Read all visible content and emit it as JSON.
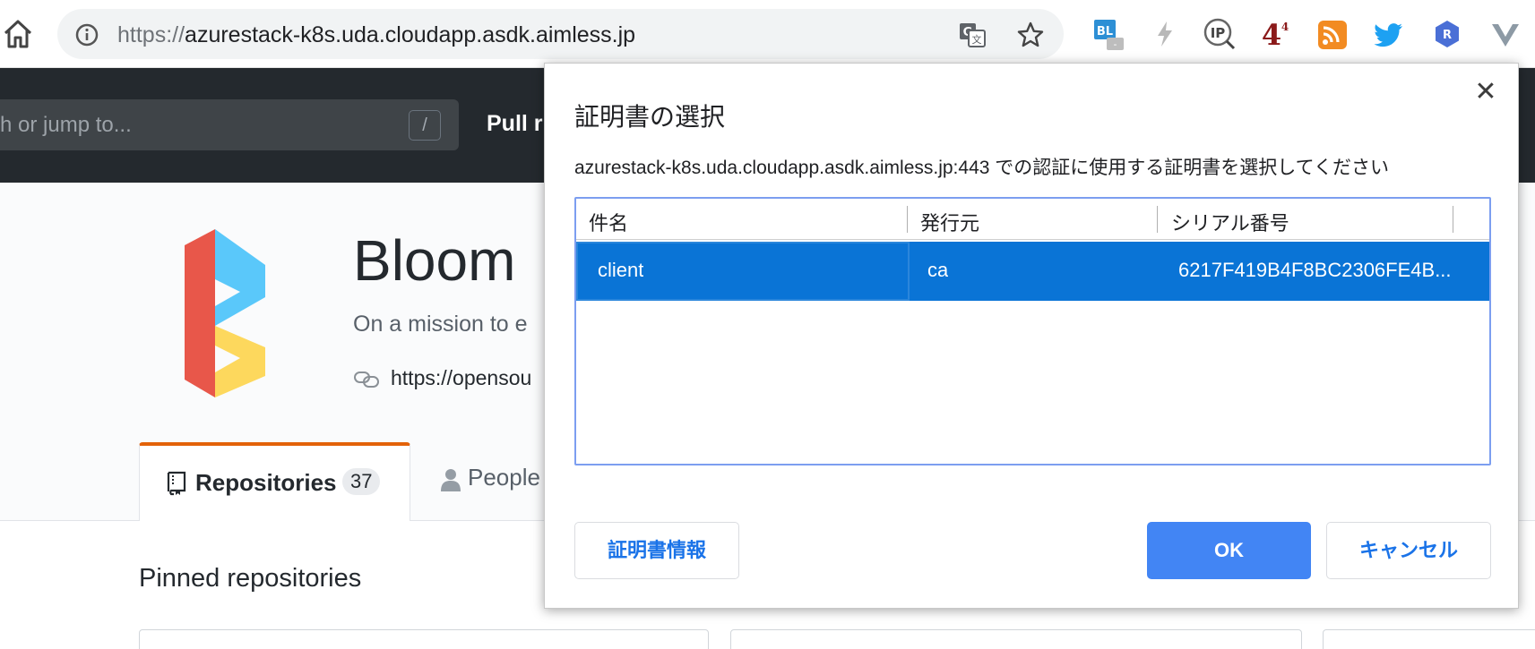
{
  "browser": {
    "url_scheme": "https://",
    "url_host": "azurestack-k8s.uda.cloudapp.asdk.aimless.jp",
    "icons": {
      "home": "home-icon",
      "info": "info-icon",
      "translate": "translate-icon",
      "bookmark": "star-icon"
    },
    "extensions": {
      "bl_label": "BL",
      "bl_badge": "-",
      "ip_label": "IP",
      "four_label": "4",
      "four_sup": "4",
      "r_label": "R"
    }
  },
  "github": {
    "search_placeholder": "h or jump to...",
    "search_shortcut": "/",
    "nav_pull": "Pull r",
    "org_name": "Bloom",
    "org_description": "On a mission to e",
    "org_link": "https://opensou",
    "tabs": {
      "repositories_label": "Repositories",
      "repositories_count": "37",
      "people_label": "People"
    },
    "pinned_title": "Pinned repositories"
  },
  "dialog": {
    "title": "証明書の選択",
    "subtitle": "azurestack-k8s.uda.cloudapp.asdk.aimless.jp:443 での認証に使用する証明書を選択してください",
    "columns": [
      "件名",
      "発行元",
      "シリアル番号"
    ],
    "rows": [
      {
        "subject": "client",
        "issuer": "ca",
        "serial": "6217F419B4F8BC2306FE4B..."
      }
    ],
    "buttons": {
      "info": "証明書情報",
      "ok": "OK",
      "cancel": "キャンセル"
    },
    "close_glyph": "✕"
  },
  "colors": {
    "github_header": "#24292e",
    "accent_tab": "#e36209",
    "selection": "#0a74d6",
    "primary_button": "#4285f4",
    "link_blue": "#1a73e8",
    "logo_red": "#e8574a",
    "logo_blue": "#5ac8fa",
    "logo_yellow": "#fdd85d"
  }
}
